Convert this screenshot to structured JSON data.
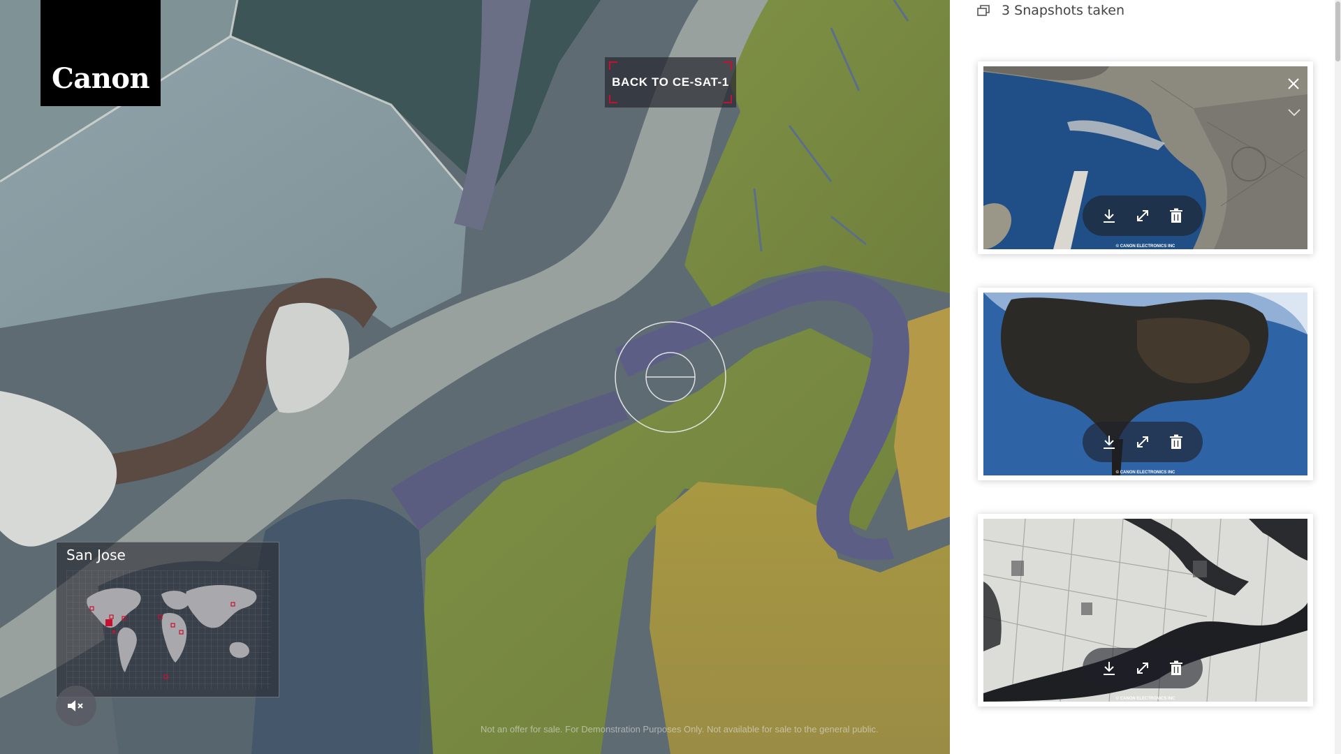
{
  "brand": {
    "logo_text": "Canon"
  },
  "navigation": {
    "back_label": "BACK TO CE-SAT-1"
  },
  "location": {
    "name": "San Jose",
    "map_markers": [
      "americas-west",
      "americas-central",
      "americas-east",
      "europe",
      "africa",
      "middle-east",
      "east-asia",
      "south-atlantic"
    ],
    "selected_marker": "americas-west"
  },
  "controls": {
    "mute_icon": "speaker-mute-icon"
  },
  "footer": {
    "disclaimer": "Not an offer for sale. For Demonstration Purposes Only. Not available for sale to the general public."
  },
  "snapshots": {
    "header": "3 Snapshots taken",
    "header_icon": "stacked-layers-icon",
    "items": [
      {
        "scene": "coastal city with marina and artificial islands",
        "credit": "© CANON ELECTRONICS INC",
        "actions": [
          "download-icon",
          "expand-icon",
          "trash-icon"
        ]
      },
      {
        "scene": "dark island in deep blue ocean",
        "credit": "© CANON ELECTRONICS INC",
        "actions": [
          "download-icon",
          "expand-icon",
          "trash-icon"
        ]
      },
      {
        "scene": "snow covered farmland with river",
        "credit": "© CANON ELECTRONICS INC",
        "actions": [
          "download-icon",
          "expand-icon",
          "trash-icon"
        ]
      }
    ]
  },
  "colors": {
    "accent_red": "#c8102e",
    "panel_dark": "#28282f",
    "text_dark": "#444444",
    "map_water": "#8a9aa6",
    "map_field_green": "#7b8b40",
    "map_field_yellow": "#a89a42",
    "map_levee": "#5d5e86"
  }
}
